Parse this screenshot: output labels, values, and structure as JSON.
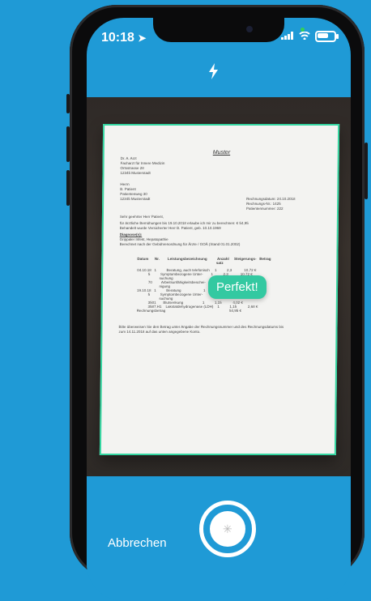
{
  "status": {
    "time": "10:18",
    "location_icon": "location-arrow-icon",
    "signal_icon": "signal-bars-icon",
    "wifi_icon": "wifi-icon",
    "battery_icon": "battery-icon",
    "battery_level": 0.7
  },
  "toolbar": {
    "flash_icon": "flash-icon"
  },
  "document": {
    "title": "Muster",
    "sender": "Dr. A. Arzt\nFacharzt für Innere Medizin\nOrtsstrasse 28\n12345 Musterstadt",
    "recipient": "Herrn\nB. Patient\nPatientenweg 30\n12345 Musterstadt",
    "invoice_info": "Rechnungsdatum: 24.10.2018\nRechnungs-Nr.: 1425\nPatientennummer: 222",
    "greeting": "Sehr geehrter Herr Patient,",
    "intro": "für ärztliche Bemühungen bis 19.10.2018 erlaube ich mir zu berechnen: € 54,95\nBehandelt wurde Versicherter Herr B. Patient, geb. 10.10.1969",
    "diagnosis_title": "Diagnose(n):",
    "diagnosis": "Grippaler Infekt, Hepatopathie\nBerechnet nach der Gebührenordnung für Ärzte / GOÄ (Stand 01.01.2002)",
    "table_head": "Datum      Nr.        Leistungsbezeichnung          Anzahl     Steigerungs-   Betrag\n                                                                              satz",
    "table_body": "04.10.18   1          Beratung, auch telefonisch     1          2,3            10,72 €\n           5          Symptombezogene Unter-        1          2,3            10,72 €\n                      suchung\n           70         Arbeitsunfähigkeitsbeschei-   1          2,3            5,36 €\n                      nigung\n19.10.18   1          Beratung                      1          2,3            10,72 €\n           5          Symptombezogene Unter-        1          2,3            10,72 €\n                      suchung\n           3501       Blutsenkung                   1          1,15           4,02 €\n           3587.H1    Lakstatdehydrogenase (LDH)    1          1,15           2,68 €\nRechnungsbetrag                                                               54,95 €",
    "footer": "Bitte überweisen Sie den Betrag unter Angabe der Rechnungsnummer und des Rechnungsdatums bis\nzum 14.11.2018 auf das unten angegebene Konto."
  },
  "toast": {
    "label": "Perfekt!"
  },
  "bottom_bar": {
    "cancel_label": "Abbrechen",
    "shutter_icon": "shutter-spinner-icon"
  }
}
